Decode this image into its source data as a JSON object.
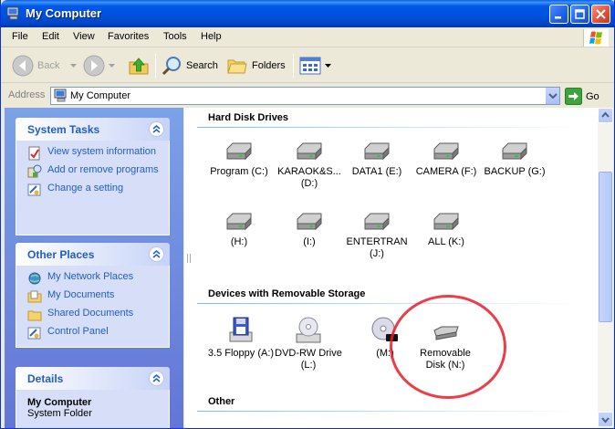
{
  "window": {
    "title": "My Computer"
  },
  "menu": [
    "File",
    "Edit",
    "View",
    "Favorites",
    "Tools",
    "Help"
  ],
  "toolbar": {
    "back": "Back",
    "search": "Search",
    "folders": "Folders"
  },
  "address": {
    "label": "Address",
    "value": "My Computer",
    "go": "Go"
  },
  "left": {
    "system_tasks": {
      "title": "System Tasks",
      "items": [
        "View system information",
        "Add or remove programs",
        "Change a setting"
      ]
    },
    "other_places": {
      "title": "Other Places",
      "items": [
        "My Network Places",
        "My Documents",
        "Shared Documents",
        "Control Panel"
      ]
    },
    "details": {
      "title": "Details",
      "name": "My Computer",
      "type": "System Folder"
    }
  },
  "groups": {
    "hdd": {
      "title": "Hard Disk Drives",
      "drives": [
        "Program (C:)",
        "KARAOK&S... (D:)",
        "DATA1 (E:)",
        "CAMERA (F:)",
        "BACKUP (G:)",
        "(H:)",
        "(I:)",
        "ENTERTRAN (J:)",
        "ALL (K:)"
      ]
    },
    "removable": {
      "title": "Devices with Removable Storage",
      "drives": [
        "3.5 Floppy (A:)",
        "DVD-RW Drive (L:)",
        "(M:)",
        "Removable Disk (N:)"
      ]
    },
    "other": {
      "title": "Other"
    }
  },
  "colors": {
    "title_bar": "#0058e6",
    "task_link": "#215dc6",
    "annotation_ring": "#e81c2a"
  }
}
